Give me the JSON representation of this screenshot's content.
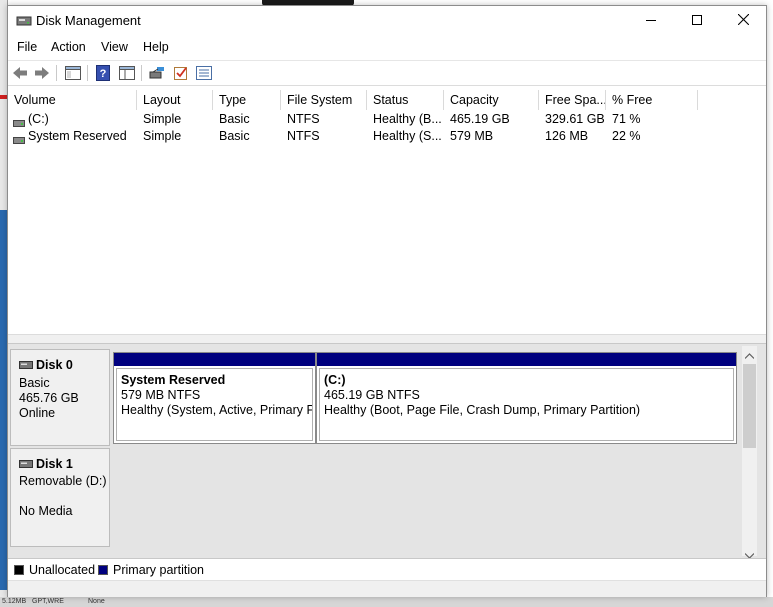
{
  "window": {
    "title": "Disk Management"
  },
  "menu": [
    "File",
    "Action",
    "View",
    "Help"
  ],
  "toolbar": [
    "back-icon",
    "forward-icon",
    "properties-icon",
    "help-icon",
    "console-tree-icon",
    "connect-icon",
    "check-icon",
    "list-view-icon"
  ],
  "volume_table": {
    "columns": [
      "Volume",
      "Layout",
      "Type",
      "File System",
      "Status",
      "Capacity",
      "Free Spa...",
      "% Free"
    ],
    "rows": [
      {
        "volume": "(C:)",
        "layout": "Simple",
        "type": "Basic",
        "fs": "NTFS",
        "status": "Healthy (B...",
        "capacity": "465.19 GB",
        "free": "329.61 GB",
        "pct": "71 %"
      },
      {
        "volume": "System Reserved",
        "layout": "Simple",
        "type": "Basic",
        "fs": "NTFS",
        "status": "Healthy (S...",
        "capacity": "579 MB",
        "free": "126 MB",
        "pct": "22 %"
      }
    ]
  },
  "disks": [
    {
      "name": "Disk 0",
      "type": "Basic",
      "size": "465.76 GB",
      "state": "Online",
      "partitions": [
        {
          "name": "System Reserved",
          "size_fs": "579 MB NTFS",
          "status": "Healthy (System, Active, Primary Pa"
        },
        {
          "name": "(C:)",
          "size_fs": "465.19 GB NTFS",
          "status": "Healthy (Boot, Page File, Crash Dump, Primary Partition)"
        }
      ]
    },
    {
      "name": "Disk 1",
      "type": "Removable (D:)",
      "state": "No Media"
    }
  ],
  "legend": [
    {
      "label": "Unallocated",
      "color": "#000000"
    },
    {
      "label": "Primary partition",
      "color": "#00007f"
    }
  ],
  "background": {
    "bottom_texts": [
      "5.12MB",
      "GPT,WRE",
      "None"
    ]
  }
}
